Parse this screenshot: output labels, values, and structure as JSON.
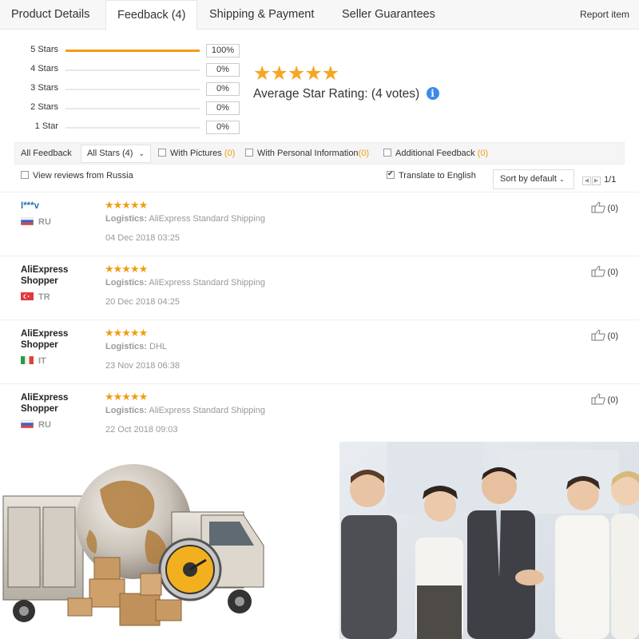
{
  "tabs": [
    {
      "label": "Product Details",
      "active": false
    },
    {
      "label": "Feedback (4)",
      "active": true
    },
    {
      "label": "Shipping & Payment",
      "active": false
    },
    {
      "label": "Seller Guarantees",
      "active": false
    }
  ],
  "report_label": "Report item",
  "histogram": [
    {
      "label": "5 Stars",
      "pct": "100%",
      "fill": 1.0
    },
    {
      "label": "4 Stars",
      "pct": "0%",
      "fill": 0
    },
    {
      "label": "3 Stars",
      "pct": "0%",
      "fill": 0
    },
    {
      "label": "2 Stars",
      "pct": "0%",
      "fill": 0
    },
    {
      "label": "1 Star",
      "pct": "0%",
      "fill": 0
    }
  ],
  "rating": {
    "stars": "★★★★★",
    "label": "Average Star Rating:",
    "votes": "(4 votes)",
    "info_icon": "i"
  },
  "filters": {
    "all_feedback": "All Feedback",
    "all_stars": "All Stars (4)",
    "with_pictures": "With Pictures",
    "with_pictures_count": "(0)",
    "with_personal": "With Personal Information",
    "with_personal_count": "(0)",
    "additional": "Additional Feedback",
    "additional_count": "(0)",
    "view_russia": "View reviews from Russia",
    "translate": "Translate to English",
    "translate_checked": true,
    "sort": "Sort by default",
    "page": "1/1"
  },
  "reviews": [
    {
      "name": "I***v",
      "is_link": true,
      "country": "RU",
      "stars": "★★★★★",
      "logistics_label": "Logistics:",
      "logistics": "AliExpress Standard Shipping",
      "date": "04 Dec 2018 03:25",
      "likes": "(0)"
    },
    {
      "name": "AliExpress Shopper",
      "is_link": false,
      "country": "TR",
      "stars": "★★★★★",
      "logistics_label": "Logistics:",
      "logistics": "AliExpress Standard Shipping",
      "date": "20 Dec 2018 04:25",
      "likes": "(0)"
    },
    {
      "name": "AliExpress Shopper",
      "is_link": false,
      "country": "IT",
      "stars": "★★★★★",
      "logistics_label": "Logistics:",
      "logistics": "DHL",
      "date": "23 Nov 2018 06:38",
      "likes": "(0)"
    },
    {
      "name": "AliExpress Shopper",
      "is_link": false,
      "country": "RU",
      "stars": "★★★★★",
      "logistics_label": "Logistics:",
      "logistics": "AliExpress Standard Shipping",
      "date": "22 Oct 2018 09:03",
      "likes": "(0)"
    }
  ],
  "colors": {
    "star": "#f39c12",
    "bar": "#f39c12",
    "link": "#2a6ebb",
    "info": "#3b8be3"
  }
}
